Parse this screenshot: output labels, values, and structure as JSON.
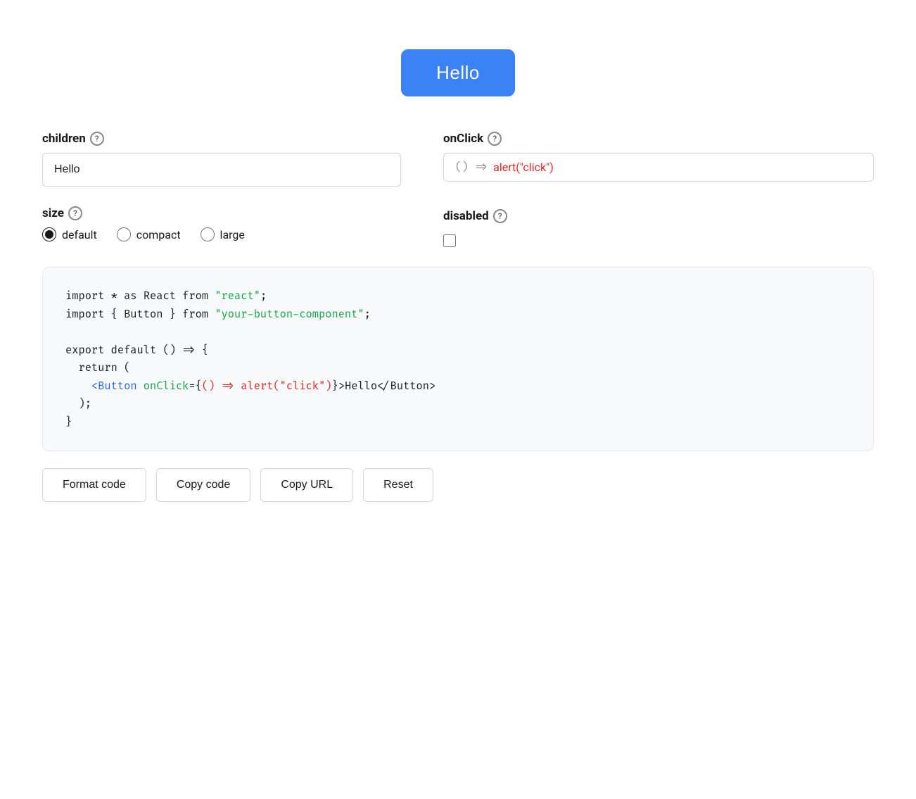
{
  "preview": {
    "button_label": "Hello",
    "button_bg": "#3b82f6"
  },
  "controls": {
    "children_label": "children",
    "children_help": "?",
    "children_value": "Hello",
    "children_placeholder": "",
    "onclick_label": "onClick",
    "onclick_help": "?",
    "onclick_prefix": "() =>",
    "onclick_value": "alert(\"click\")",
    "size_label": "size",
    "size_help": "?",
    "size_options": [
      "default",
      "compact",
      "large"
    ],
    "size_selected": "default",
    "disabled_label": "disabled",
    "disabled_help": "?"
  },
  "code": {
    "line1": "import * as React from ",
    "line1_str": "\"react\"",
    "line1_end": ";",
    "line2_start": "import { Button } from ",
    "line2_str": "\"your-button-component\"",
    "line2_end": ";",
    "line4": "export default () => {",
    "line5": "  return (",
    "line6_open": "    <Button",
    "line6_attr": " onClick",
    "line6_eq": "={",
    "line6_fn": "() => alert(\"click\")",
    "line6_close_tag": "}>Hello</Button>",
    "line7": "  );",
    "line8": "}"
  },
  "actions": {
    "format_code": "Format code",
    "copy_code": "Copy code",
    "copy_url": "Copy URL",
    "reset": "Reset"
  }
}
